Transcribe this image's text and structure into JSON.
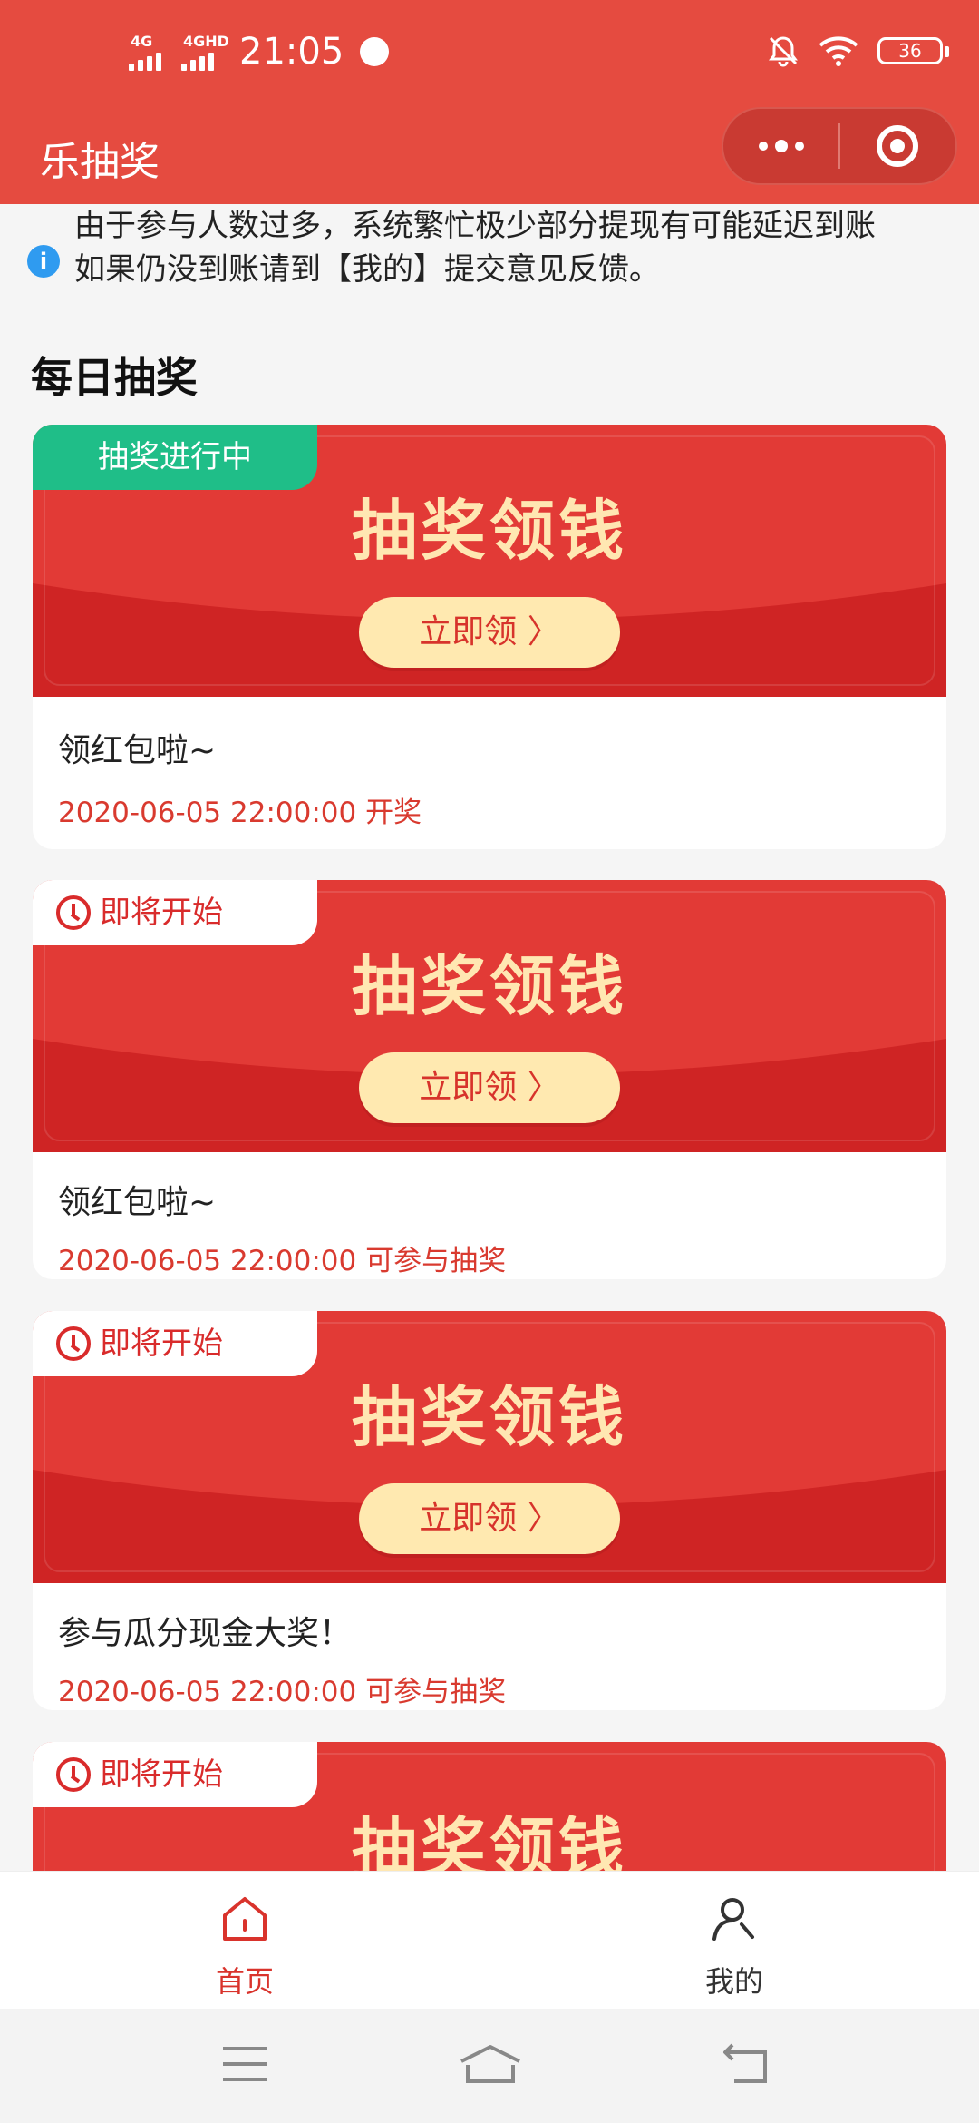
{
  "status_bar": {
    "network_1": "4G",
    "network_2": "4GHD",
    "time": "21:05",
    "battery": "36"
  },
  "nav": {
    "title": "乐抽奖"
  },
  "notice": {
    "line1": "由于参与人数过多，系统繁忙极少部分提现有可能延迟到账",
    "line2": "如果仍没到账请到【我的】提交意见反馈。"
  },
  "section": {
    "title": "每日抽奖"
  },
  "cards": [
    {
      "tag": "抽奖进行中",
      "tag_type": "live",
      "banner_title": "抽奖领钱",
      "button": "立即领 〉",
      "name": "领红包啦~",
      "time": "2020-06-05 22:00:00 开奖"
    },
    {
      "tag": "即将开始",
      "tag_type": "soon",
      "banner_title": "抽奖领钱",
      "button": "立即领 〉",
      "name": "领红包啦~",
      "time": "2020-06-05 22:00:00 可参与抽奖"
    },
    {
      "tag": "即将开始",
      "tag_type": "soon",
      "banner_title": "抽奖领钱",
      "button": "立即领 〉",
      "name": "参与瓜分现金大奖！",
      "time": "2020-06-05 22:00:00 可参与抽奖"
    },
    {
      "tag": "即将开始",
      "tag_type": "soon",
      "banner_title": "抽奖领钱"
    }
  ],
  "tabbar": {
    "home": "首页",
    "mine": "我的",
    "active_color": "#d9332c",
    "inactive_color": "#333333"
  },
  "colors": {
    "brand_red": "#e54b40",
    "live_green": "#1fbe88",
    "gold_text": "#ffe7b2"
  }
}
